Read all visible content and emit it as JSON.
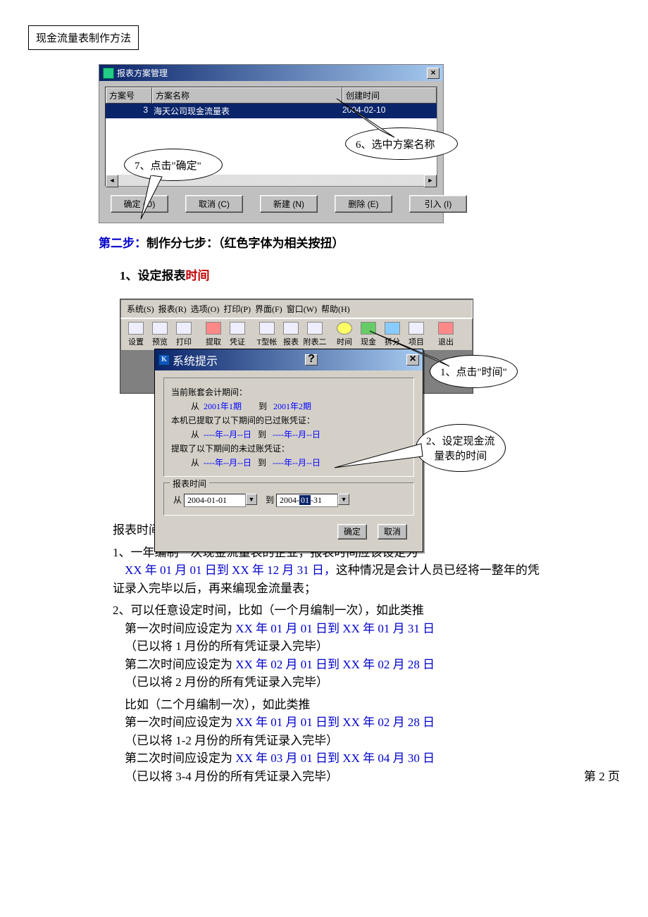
{
  "page_header": "现金流量表制作方法",
  "dialog1": {
    "title": "报表方案管理",
    "cols": {
      "c1": "方案号",
      "c2": "方案名称",
      "c3": "创建时间"
    },
    "row": {
      "no": "3",
      "name": "海天公司现金流量表",
      "date": "2004-02-10"
    },
    "btns": {
      "ok": "确定 (O)",
      "cancel": "取消 (C)",
      "newb": "新建 (N)",
      "del": "删除 (E)",
      "imp": "引入 (I)"
    }
  },
  "callouts": {
    "c6": "6、选中方案名称",
    "c7": "7、点击\"确定\"",
    "t1": "1、点击\"时间\"",
    "t2a": "2、设定现金流",
    "t2b": "量表的时间"
  },
  "step2": {
    "label": "第二步：",
    "rest": "制作分七步：（红色字体为相关按扭）"
  },
  "sub1": {
    "no": "1、",
    "a": "设定报表",
    "b": "时间"
  },
  "menu": {
    "m1": "系统(S)",
    "m2": "报表(R)",
    "m3": "选项(O)",
    "m4": "打印(P)",
    "m5": "界面(F)",
    "m6": "窗口(W)",
    "m7": "帮助(H)"
  },
  "tool": {
    "t1": "设置",
    "t2": "预览",
    "t3": "打印",
    "t4": "提取",
    "t5": "凭证",
    "t6": "T型帐",
    "t7": "报表",
    "t8": "附表二",
    "t9": "时间",
    "t10": "现金",
    "t11": "拆分",
    "t12": "项目",
    "t13": "退出"
  },
  "modal": {
    "title": "系统提示",
    "l1": "当前账套会计期间：",
    "l2a": "从",
    "l2b": "2001年1期",
    "l2c": "到",
    "l2d": "2001年2期",
    "l3": "本机已提取了以下期间的已过账凭证：",
    "l4a": "从",
    "l4b": "----年--月--日",
    "l4c": "到",
    "l4d": "----年--月--日",
    "l5": "提取了以下期间的未过账凭证：",
    "l6a": "从",
    "l6b": "----年--月--日",
    "l6c": "到",
    "l6d": "----年--月--日",
    "g2": "报表时间",
    "d1": "2004-01-01",
    "d2a": "2004-",
    "d2sel": "01",
    "d2b": "-31",
    "from": "从",
    "to": "到",
    "ok": "确定",
    "cancel": "取消"
  },
  "body": {
    "p0": "报表时间的设定为二种情况：",
    "p1a": "1、一年编制一次现金流量表的企业，报表时间应该设定为",
    "p1b": "XX 年 01 月 01 日到  XX 年 12 月 31 日，",
    "p1c": "这种情况是会计人员已经将一整年的凭证录入完毕以后，再来编现金流量表；",
    "p2a": "2、可以任意设定时间，比如（一个月编制一次），如此类推",
    "p2b": "第一次时间应设定为 ",
    "p2c": "XX 年 01 月 01 日到 XX 年 01 月 31 日",
    "p2d": "（已以将 1 月份的所有凭证录入完毕）",
    "p2e": "第二次时间应设定为 ",
    "p2f": "XX 年 02 月 01 日到 XX 年 02 月 28 日",
    "p2g": "（已以将 2 月份的所有凭证录入完毕）",
    "p3a": "比如（二个月编制一次），如此类推",
    "p3b": "第一次时间应设定为 ",
    "p3c": "XX 年 01 月 01 日到 XX 年 02 月 28 日",
    "p3d": "（已以将 1-2 月份的所有凭证录入完毕）",
    "p3e": "第二次时间应设定为 ",
    "p3f": "XX 年 03 月 01 日到 XX 年 04 月 30 日",
    "p3g": "（已以将 3-4 月份的所有凭证录入完毕）"
  },
  "footer": "第 2 页"
}
